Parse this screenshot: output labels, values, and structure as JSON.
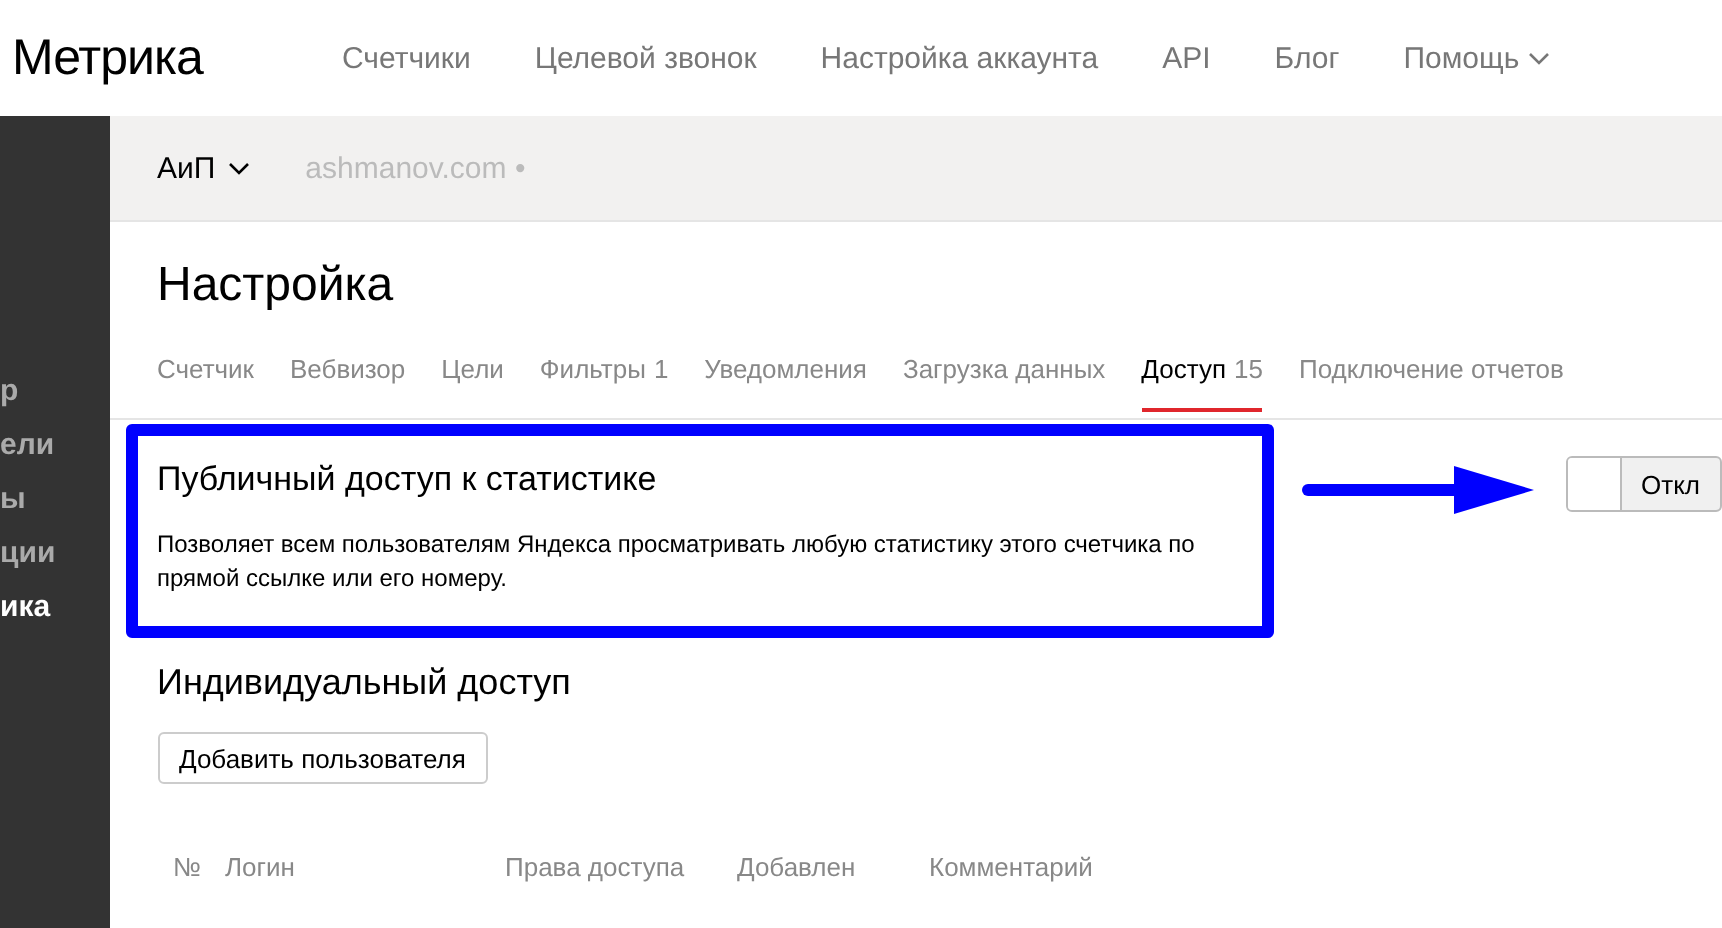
{
  "header": {
    "logo": "Метрика",
    "nav": [
      {
        "label": "Счетчики",
        "dropdown": false
      },
      {
        "label": "Целевой звонок",
        "dropdown": false
      },
      {
        "label": "Настройка аккаунта",
        "dropdown": false
      },
      {
        "label": "API",
        "dropdown": false
      },
      {
        "label": "Блог",
        "dropdown": false
      },
      {
        "label": "Помощь",
        "dropdown": true
      }
    ]
  },
  "sidebar": {
    "items": [
      {
        "label": "р",
        "selected": false
      },
      {
        "label": "ели",
        "selected": false
      },
      {
        "label": "ы",
        "selected": false
      },
      {
        "label": "ции",
        "selected": false
      },
      {
        "label": "ика",
        "selected": true
      }
    ]
  },
  "counter_bar": {
    "counter": "АиП",
    "site": "ashmanov.com •"
  },
  "page_title": "Настройка",
  "tabs": [
    {
      "label": "Счетчик",
      "selected": false
    },
    {
      "label": "Вебвизор",
      "selected": false
    },
    {
      "label": "Цели",
      "selected": false
    },
    {
      "label": "Фильтры",
      "count": "1",
      "selected": false
    },
    {
      "label": "Уведомления",
      "selected": false
    },
    {
      "label": "Загрузка данных",
      "selected": false
    },
    {
      "label": "Доступ",
      "count": "15",
      "selected": true
    },
    {
      "label": "Подключение отчетов",
      "selected": false
    }
  ],
  "public_access": {
    "title": "Публичный доступ к статистике",
    "description": "Позволяет всем пользователям Яндекса просматривать любую статистику этого счетчика по прямой ссылке или его номеру.",
    "toggle": {
      "on": false,
      "label": "Откл"
    }
  },
  "individual_access": {
    "title": "Индивидуальный доступ",
    "add_button": "Добавить пользователя",
    "table": {
      "columns": [
        "№",
        "Логин",
        "Права доступа",
        "Добавлен",
        "Комментарий"
      ]
    }
  }
}
